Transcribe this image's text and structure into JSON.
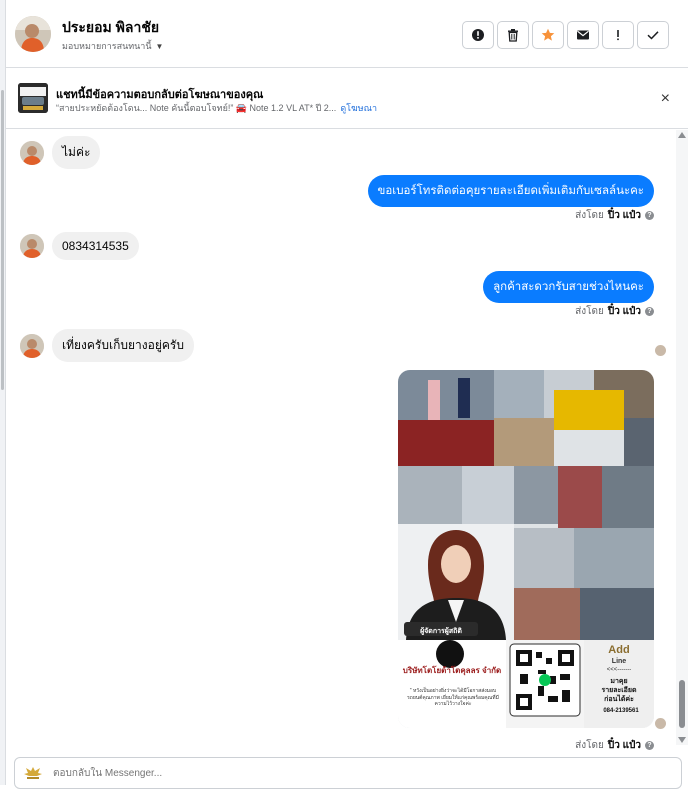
{
  "header": {
    "name": "ประยอม พิลาชัย",
    "assign_label": "มอบหมายการสนทนานี้",
    "actions": [
      {
        "icon": "alert-circle-icon",
        "name": "mark-spam-button"
      },
      {
        "icon": "trash-icon",
        "name": "delete-button"
      },
      {
        "icon": "star-icon",
        "name": "star-button"
      },
      {
        "icon": "envelope-icon",
        "name": "mark-unread-button"
      },
      {
        "icon": "exclamation-icon",
        "name": "follow-up-button"
      },
      {
        "icon": "check-icon",
        "name": "mark-done-button"
      }
    ],
    "accent_star": "#f7923a"
  },
  "ad_banner": {
    "title": "แชทนี้มีข้อความตอบกลับต่อโฆษณาของคุณ",
    "subtitle": "“สายประหยัดต้องโดน... Note คันนี้ตอบโจทย์!” 🚘 Note 1.2 VL AT* ปี 2...",
    "link": "ดูโฆษณา",
    "close": "×"
  },
  "messages": [
    {
      "dir": "in",
      "text": "ไม่ค่ะ"
    },
    {
      "dir": "out",
      "text": "ขอเบอร์โทรติดต่อคุยรายละเอียดเพิ่มเติมกับเซลล์นะคะ",
      "sent_prefix": "ส่งโดย",
      "sender": "ปิ๋ว แป๋ว"
    },
    {
      "dir": "in",
      "text": "0834314535"
    },
    {
      "dir": "out",
      "text": "ลูกค้าสะดวกรับสายช่วงไหนคะ",
      "sent_prefix": "ส่งโดย",
      "sender": "ปิ๋ว แป๋ว"
    },
    {
      "dir": "in",
      "text": "เที่ยงครับเก็บยางอยู่ครับ"
    },
    {
      "dir": "out-image",
      "sent_prefix": "ส่งโดย",
      "sender": "ปิ๋ว แป๋ว"
    }
  ],
  "poster": {
    "badge": "ผู้จัดการผู้สถิติ",
    "company": "บริษัทโตโยต้าโตคุลลร จำกัด",
    "slogan": "\" หวังเป็นอย่างยิ่งว่าจะได้มีโอกาสส่งมอบรถยนต์คุณภาพ เยี่ยมให้แก่คุณพร้อมคุณที่มีความไว้วางใจค่ะ",
    "add_title": "Add",
    "add_line": "Line",
    "add_arrow": "<<<-------",
    "add_text1": "มาคุย",
    "add_text2": "รายละเอียด",
    "add_text3": "ก่อนได้ค่ะ",
    "phone": "084-2139561"
  },
  "composer": {
    "placeholder": "ตอบกลับใน Messenger..."
  },
  "colors": {
    "outgoing_bubble": "#0a7cff",
    "incoming_bubble": "#f0f0f0",
    "link": "#216fdb"
  }
}
